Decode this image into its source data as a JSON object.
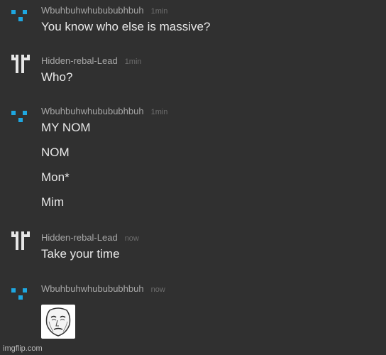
{
  "messages": [
    {
      "author": "Wbuhbuhwhubububhbuh",
      "time": "1min",
      "lines": [
        "You know who else is massive?"
      ],
      "avatar_icon": "blue-pixel-avatar-icon",
      "avatar_color": "#1ea7e1"
    },
    {
      "author": "Hidden-rebal-Lead",
      "time": "1min",
      "lines": [
        "Who?"
      ],
      "avatar_icon": "white-pixel-avatar-icon",
      "avatar_color": "#e6e6e6"
    },
    {
      "author": "Wbuhbuhwhubububhbuh",
      "time": "1min",
      "lines": [
        "MY NOM",
        "NOM",
        "Mon*",
        "Mim"
      ],
      "avatar_icon": "blue-pixel-avatar-icon",
      "avatar_color": "#1ea7e1"
    },
    {
      "author": "Hidden-rebal-Lead",
      "time": "now",
      "lines": [
        "Take your time"
      ],
      "avatar_icon": "white-pixel-avatar-icon",
      "avatar_color": "#e6e6e6"
    },
    {
      "author": "Wbuhbuhwhubububhbuh",
      "time": "now",
      "attachment": "okay-face-meme-sticker",
      "avatar_icon": "blue-pixel-avatar-icon",
      "avatar_color": "#1ea7e1"
    }
  ],
  "watermark": "imgflip.com"
}
